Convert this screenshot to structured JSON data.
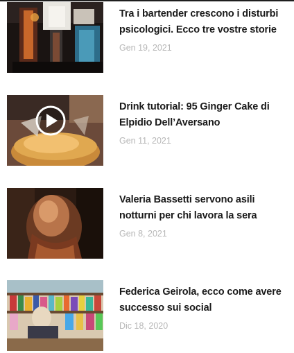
{
  "articles": [
    {
      "title": "Tra i bartender crescono i disturbi psicologici. Ecco tre vostre storie",
      "date": "Gen 19, 2021",
      "thumb_icon": "bartender-photo",
      "video": false
    },
    {
      "title": "Drink tutorial: 95 Ginger Cake di Elpidio Dell’Aversano",
      "date": "Gen 11, 2021",
      "thumb_icon": "cocktail-photo",
      "video": true
    },
    {
      "title": "Valeria Bassetti servono asili notturni per chi lavora la sera",
      "date": "Gen 8, 2021",
      "thumb_icon": "portrait-photo",
      "video": false
    },
    {
      "title": "Federica Geirola, ecco come avere successo sui social",
      "date": "Dic 18, 2020",
      "thumb_icon": "bar-shelf-photo",
      "video": false
    }
  ]
}
